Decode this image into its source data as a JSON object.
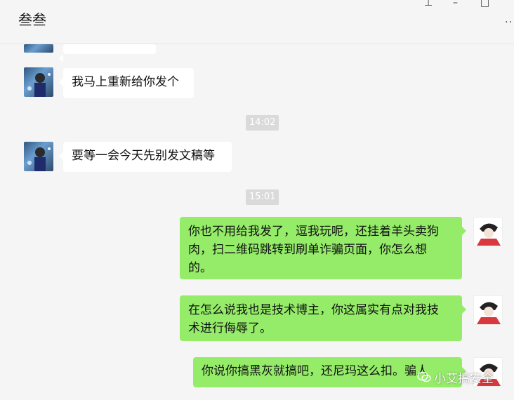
{
  "window": {
    "title": "叁叁",
    "pin_icon": "pin-icon",
    "minimize_icon": "minimize-icon",
    "maximize_icon": "maximize-icon",
    "more_icon": "more-icon"
  },
  "messages": [
    {
      "side": "left",
      "text": ""
    },
    {
      "side": "left",
      "text": "我马上重新给你发个"
    },
    {
      "side": "time",
      "text": "14:02"
    },
    {
      "side": "left",
      "text": "要等一会今天先别发文稿等"
    },
    {
      "side": "time",
      "text": "15:01"
    },
    {
      "side": "right",
      "lines": [
        "你也不用给我发了，逗我玩呢，还挂着羊头卖狗",
        "肉，扫二维码跳转到刷单诈骗页面，你怎么想",
        "的。"
      ]
    },
    {
      "side": "right",
      "lines": [
        "在怎么说我也是技术博主，你这属实有点对我技",
        "术进行侮辱了。"
      ]
    },
    {
      "side": "right",
      "lines": [
        "你说你搞黑灰就搞吧，还尼玛这么扣。骗人"
      ]
    }
  ],
  "watermark": {
    "text": "小艾搞安全",
    "icon": "wechat-icon"
  },
  "colors": {
    "sent_bubble": "#95ec69",
    "received_bubble": "#ffffff",
    "background": "#f5f5f5"
  }
}
